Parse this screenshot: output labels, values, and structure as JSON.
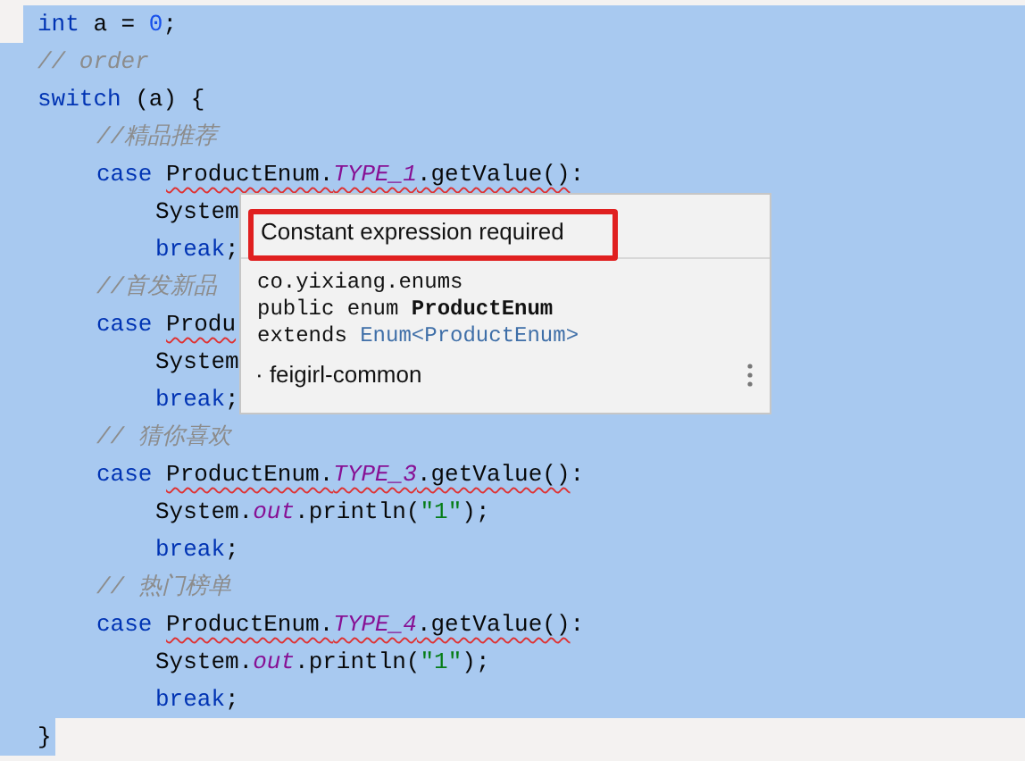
{
  "editor": {
    "lines": [
      {
        "selected": true,
        "kind": "partial_start",
        "tokens": [
          {
            "kind": "keyword",
            "text": "int",
            "error": false
          },
          {
            "kind": "plain",
            "text": " a = ",
            "error": false
          },
          {
            "kind": "number",
            "text": "0",
            "error": false
          },
          {
            "kind": "plain",
            "text": ";",
            "error": false
          }
        ]
      },
      {
        "selected": true,
        "kind": "full",
        "tokens": [
          {
            "kind": "comment",
            "text": "// order",
            "error": false
          }
        ]
      },
      {
        "selected": true,
        "kind": "full",
        "tokens": [
          {
            "kind": "keyword",
            "text": "switch",
            "error": false
          },
          {
            "kind": "plain",
            "text": " (a) {",
            "error": false
          }
        ],
        "children": [
          {
            "selected": true,
            "kind": "full",
            "tokens": [
              {
                "kind": "comment",
                "text": "//精品推荐",
                "error": false
              }
            ]
          },
          {
            "selected": true,
            "kind": "full",
            "tokens": [
              {
                "kind": "keyword",
                "text": "case ",
                "error": false
              },
              {
                "kind": "plain",
                "text": "ProductEnum.",
                "error": true
              },
              {
                "kind": "field",
                "text": "TYPE_1",
                "error": true
              },
              {
                "kind": "plain",
                "text": ".getValue()",
                "error": true
              },
              {
                "kind": "plain",
                "text": ":",
                "error": false
              }
            ],
            "children": [
              {
                "selected": true,
                "kind": "full",
                "tokens": [
                  {
                    "kind": "plain",
                    "text": "System",
                    "error": false
                  }
                ]
              },
              {
                "selected": true,
                "kind": "full",
                "tokens": [
                  {
                    "kind": "keyword",
                    "text": "break",
                    "error": false
                  },
                  {
                    "kind": "plain",
                    "text": ";",
                    "error": false
                  }
                ]
              }
            ]
          },
          {
            "selected": true,
            "kind": "full",
            "tokens": [
              {
                "kind": "comment",
                "text": "//首发新品",
                "error": false
              }
            ]
          },
          {
            "selected": true,
            "kind": "full",
            "tokens": [
              {
                "kind": "keyword",
                "text": "case ",
                "error": false
              },
              {
                "kind": "plain",
                "text": "Produ",
                "error": true
              }
            ],
            "children": [
              {
                "selected": true,
                "kind": "full",
                "tokens": [
                  {
                    "kind": "plain",
                    "text": "System",
                    "error": false
                  }
                ]
              },
              {
                "selected": true,
                "kind": "full",
                "tokens": [
                  {
                    "kind": "keyword",
                    "text": "break",
                    "error": false
                  },
                  {
                    "kind": "plain",
                    "text": ";",
                    "error": false
                  }
                ]
              }
            ]
          },
          {
            "selected": true,
            "kind": "full",
            "tokens": [
              {
                "kind": "comment",
                "text": "// 猜你喜欢",
                "error": false
              }
            ]
          },
          {
            "selected": true,
            "kind": "full",
            "tokens": [
              {
                "kind": "keyword",
                "text": "case ",
                "error": false
              },
              {
                "kind": "plain",
                "text": "ProductEnum.",
                "error": true
              },
              {
                "kind": "field",
                "text": "TYPE_3",
                "error": true
              },
              {
                "kind": "plain",
                "text": ".getValue()",
                "error": true
              },
              {
                "kind": "plain",
                "text": ":",
                "error": false
              }
            ],
            "children": [
              {
                "selected": true,
                "kind": "full",
                "tokens": [
                  {
                    "kind": "plain",
                    "text": "System.",
                    "error": false
                  },
                  {
                    "kind": "field",
                    "text": "out",
                    "error": false
                  },
                  {
                    "kind": "plain",
                    "text": ".println(",
                    "error": false
                  },
                  {
                    "kind": "string",
                    "text": "\"1\"",
                    "error": false
                  },
                  {
                    "kind": "plain",
                    "text": ");",
                    "error": false
                  }
                ]
              },
              {
                "selected": true,
                "kind": "full",
                "tokens": [
                  {
                    "kind": "keyword",
                    "text": "break",
                    "error": false
                  },
                  {
                    "kind": "plain",
                    "text": ";",
                    "error": false
                  }
                ]
              }
            ]
          },
          {
            "selected": true,
            "kind": "full",
            "tokens": [
              {
                "kind": "comment",
                "text": "// 热门榜单",
                "error": false
              }
            ]
          },
          {
            "selected": true,
            "kind": "full",
            "tokens": [
              {
                "kind": "keyword",
                "text": "case ",
                "error": false
              },
              {
                "kind": "plain",
                "text": "ProductEnum.",
                "error": true
              },
              {
                "kind": "field",
                "text": "TYPE_4",
                "error": true
              },
              {
                "kind": "plain",
                "text": ".getValue()",
                "error": true
              },
              {
                "kind": "plain",
                "text": ":",
                "error": false
              }
            ],
            "children": [
              {
                "selected": true,
                "kind": "full",
                "tokens": [
                  {
                    "kind": "plain",
                    "text": "System.",
                    "error": false
                  },
                  {
                    "kind": "field",
                    "text": "out",
                    "error": false
                  },
                  {
                    "kind": "plain",
                    "text": ".println(",
                    "error": false
                  },
                  {
                    "kind": "string",
                    "text": "\"1\"",
                    "error": false
                  },
                  {
                    "kind": "plain",
                    "text": ");",
                    "error": false
                  }
                ]
              },
              {
                "selected": true,
                "kind": "full",
                "tokens": [
                  {
                    "kind": "keyword",
                    "text": "break",
                    "error": false
                  },
                  {
                    "kind": "plain",
                    "text": ";",
                    "error": false
                  }
                ]
              }
            ]
          }
        ]
      },
      {
        "selected": true,
        "kind": "partial_end",
        "tokens": [
          {
            "kind": "plain",
            "text": "}",
            "error": false
          }
        ]
      }
    ]
  },
  "popup": {
    "message": "Constant expression required",
    "highlighted": true,
    "declaration": [
      "co.yixiang.enums",
      "public enum **ProductEnum**",
      "extends Enum<ProductEnum>"
    ],
    "module": "· feigirl-common"
  }
}
